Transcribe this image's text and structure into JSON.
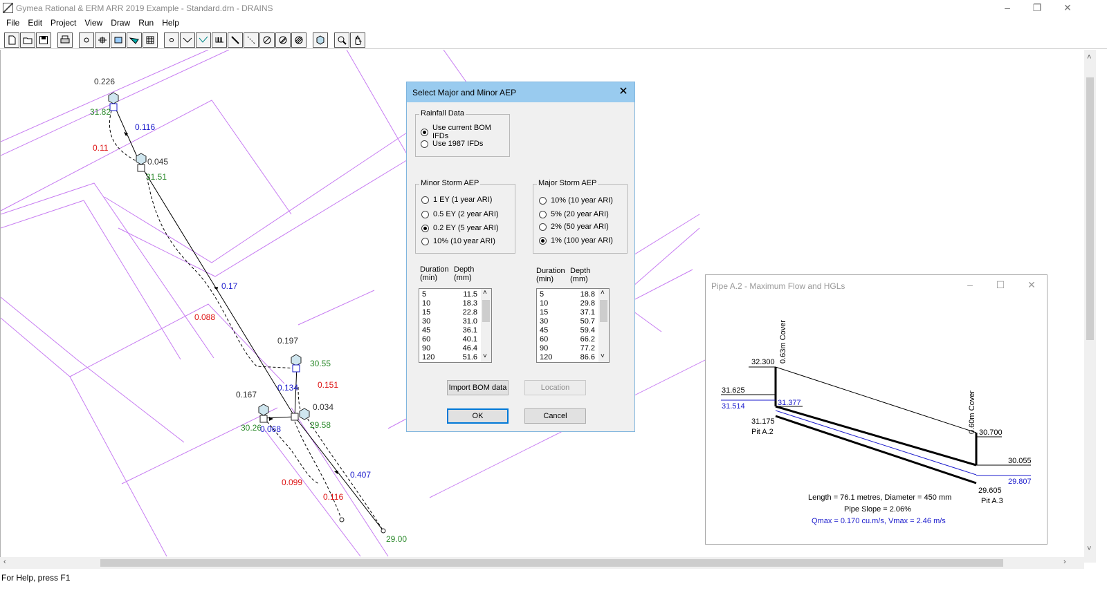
{
  "window": {
    "title": "Gymea Rational & ERM ARR 2019 Example - Standard.drn - DRAINS",
    "minimize": "–",
    "restore": "❐",
    "close": "✕"
  },
  "menu": [
    "File",
    "Edit",
    "Project",
    "View",
    "Draw",
    "Run",
    "Help"
  ],
  "canvas": {
    "labels": [
      {
        "text": "0.226",
        "color": "#333333"
      },
      {
        "text": "31.82",
        "color": "#2e8b2e"
      },
      {
        "text": "0.116",
        "color": "#1a1acc"
      },
      {
        "text": "0.11",
        "color": "#dd1111"
      },
      {
        "text": "0.045",
        "color": "#333333"
      },
      {
        "text": "31.51",
        "color": "#2e8b2e"
      },
      {
        "text": "0.17",
        "color": "#1a1acc"
      },
      {
        "text": "0.088",
        "color": "#dd1111"
      },
      {
        "text": "0.197",
        "color": "#333333"
      },
      {
        "text": "30.55",
        "color": "#2e8b2e"
      },
      {
        "text": "0.134",
        "color": "#1a1acc"
      },
      {
        "text": "0.151",
        "color": "#dd1111"
      },
      {
        "text": "0.167",
        "color": "#333333"
      },
      {
        "text": "0.034",
        "color": "#333333"
      },
      {
        "text": "30.26",
        "color": "#2e8b2e"
      },
      {
        "text": "0.068",
        "color": "#1a1acc"
      },
      {
        "text": "29.58",
        "color": "#2e8b2e"
      },
      {
        "text": "0.407",
        "color": "#1a1acc"
      },
      {
        "text": "0.099",
        "color": "#dd1111"
      },
      {
        "text": "0.116",
        "color": "#dd1111"
      },
      {
        "text": "29.00",
        "color": "#2e8b2e"
      }
    ]
  },
  "status": "For Help, press F1",
  "dialog": {
    "title": "Select Major and Minor AEP",
    "rainfall": {
      "title": "Rainfall Data",
      "options": [
        {
          "label": "Use current BOM IFDs",
          "checked": true
        },
        {
          "label": "Use 1987 IFDs",
          "checked": false
        }
      ]
    },
    "minor": {
      "title": "Minor Storm AEP",
      "options": [
        {
          "label": "1 EY (1 year ARI)",
          "checked": false
        },
        {
          "label": "0.5 EY (2 year ARI)",
          "checked": false
        },
        {
          "label": "0.2 EY (5 year ARI)",
          "checked": true
        },
        {
          "label": "10% (10 year ARI)",
          "checked": false
        }
      ],
      "col_duration": "Duration",
      "col_duration_unit": "(min)",
      "col_depth": "Depth",
      "col_depth_unit": "(mm)",
      "rows": [
        {
          "dur": "5",
          "dep": "11.5"
        },
        {
          "dur": "10",
          "dep": "18.3"
        },
        {
          "dur": "15",
          "dep": "22.8"
        },
        {
          "dur": "30",
          "dep": "31.0"
        },
        {
          "dur": "45",
          "dep": "36.1"
        },
        {
          "dur": "60",
          "dep": "40.1"
        },
        {
          "dur": "90",
          "dep": "46.4"
        },
        {
          "dur": "120",
          "dep": "51.6"
        }
      ]
    },
    "major": {
      "title": "Major Storm AEP",
      "options": [
        {
          "label": "10% (10 year ARI)",
          "checked": false
        },
        {
          "label": "5% (20 year ARI)",
          "checked": false
        },
        {
          "label": "2% (50 year ARI)",
          "checked": false
        },
        {
          "label": "1% (100 year ARI)",
          "checked": true
        }
      ],
      "col_duration": "Duration",
      "col_duration_unit": "(min)",
      "col_depth": "Depth",
      "col_depth_unit": "(mm)",
      "rows": [
        {
          "dur": "5",
          "dep": "18.8"
        },
        {
          "dur": "10",
          "dep": "29.8"
        },
        {
          "dur": "15",
          "dep": "37.1"
        },
        {
          "dur": "30",
          "dep": "50.7"
        },
        {
          "dur": "45",
          "dep": "59.4"
        },
        {
          "dur": "60",
          "dep": "66.2"
        },
        {
          "dur": "90",
          "dep": "77.2"
        },
        {
          "dur": "120",
          "dep": "86.6"
        }
      ]
    },
    "import_label": "Import BOM data",
    "location_label": "Location",
    "ok_label": "OK",
    "cancel_label": "Cancel"
  },
  "pipe_window": {
    "title": "Pipe A.2 - Maximum Flow and HGLs",
    "cover_up": "0.63m Cover",
    "cover_down": "0.60m Cover",
    "us_surface": "32.300",
    "us_hgl_major": "31.625",
    "us_hgl_minor": "31.514",
    "us_obvert": "31.377",
    "us_invert": "31.175",
    "us_pit": "Pit A.2",
    "ds_surface": "30.700",
    "ds_hgl_major": "30.055",
    "ds_hgl_minor": "29.807",
    "ds_invert": "29.605",
    "ds_pit": "Pit A.3",
    "length_text": "Length = 76.1 metres,  Diameter = 450 mm",
    "slope_text": "Pipe Slope = 2.06%",
    "flow_text": "Qmax = 0.170 cu.m/s,  Vmax = 2.46 m/s"
  }
}
